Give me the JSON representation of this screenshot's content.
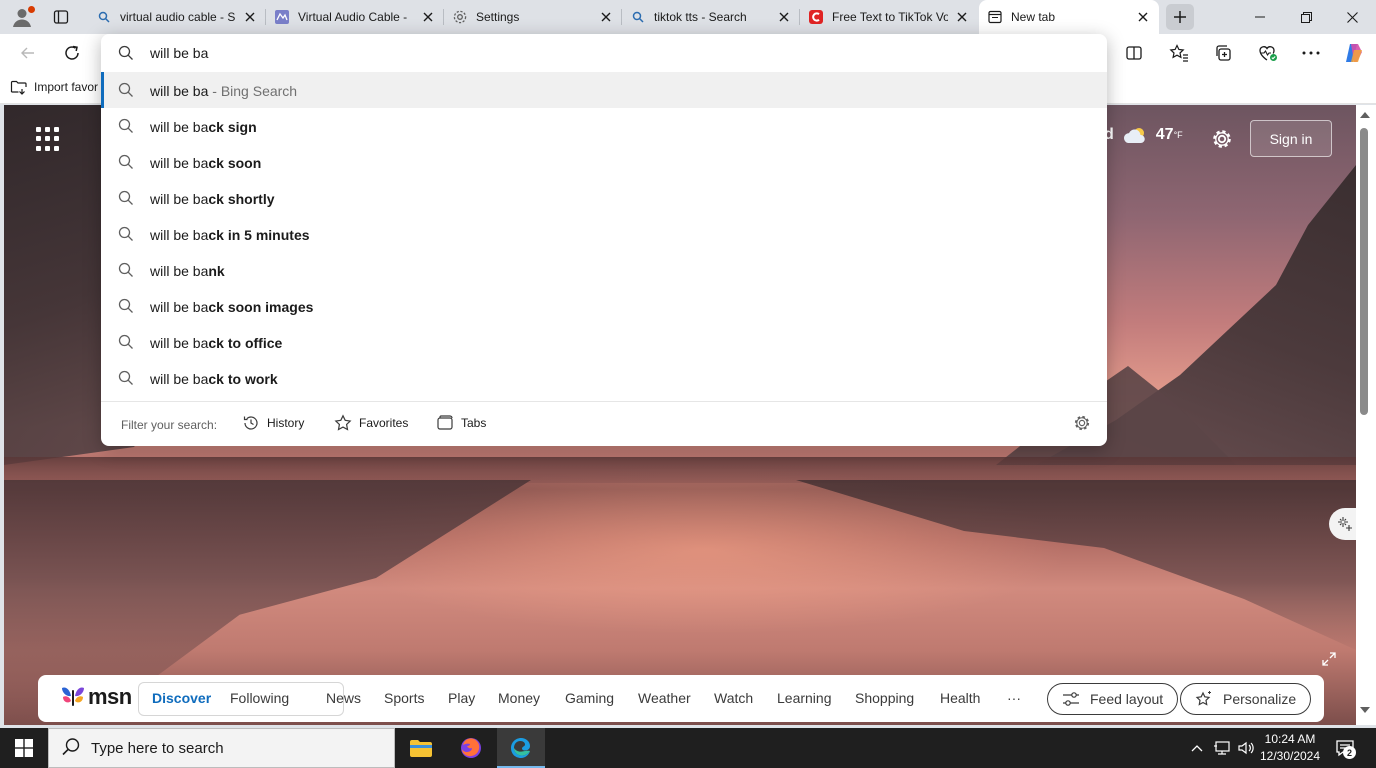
{
  "tabs": [
    {
      "title": "virtual audio cable - S",
      "favicon": "search-icon",
      "active": false
    },
    {
      "title": "Virtual Audio Cable -",
      "favicon": "vac-icon",
      "active": false
    },
    {
      "title": "Settings",
      "favicon": "gear-icon",
      "active": false
    },
    {
      "title": "tiktok tts - Search",
      "favicon": "search-icon",
      "active": false
    },
    {
      "title": "Free Text to TikTok Vo",
      "favicon": "red-c-icon",
      "active": false
    },
    {
      "title": "New tab",
      "favicon": "newtab-icon",
      "active": true
    }
  ],
  "favorites_bar": {
    "import_label": "Import favor"
  },
  "address": {
    "value": "will be ba",
    "suggestions": [
      {
        "typed": "will be ba",
        "completion": "",
        "suffix": " - Bing Search",
        "highlighted": true
      },
      {
        "typed": "will be ba",
        "completion": "ck sign",
        "suffix": "",
        "highlighted": false
      },
      {
        "typed": "will be ba",
        "completion": "ck soon",
        "suffix": "",
        "highlighted": false
      },
      {
        "typed": "will be ba",
        "completion": "ck shortly",
        "suffix": "",
        "highlighted": false
      },
      {
        "typed": "will be ba",
        "completion": "ck in 5 minutes",
        "suffix": "",
        "highlighted": false
      },
      {
        "typed": "will be ba",
        "completion": "nk",
        "suffix": "",
        "highlighted": false
      },
      {
        "typed": "will be ba",
        "completion": "ck soon images",
        "suffix": "",
        "highlighted": false
      },
      {
        "typed": "will be ba",
        "completion": "ck to office",
        "suffix": "",
        "highlighted": false
      },
      {
        "typed": "will be ba",
        "completion": "ck to work",
        "suffix": "",
        "highlighted": false
      }
    ],
    "filter_label": "Filter your search:",
    "filters": [
      {
        "label": "History",
        "icon": "history-icon"
      },
      {
        "label": "Favorites",
        "icon": "star-icon"
      },
      {
        "label": "Tabs",
        "icon": "tabs-icon"
      }
    ]
  },
  "page": {
    "weather_location_fragment": "d",
    "weather_temp": "47",
    "weather_unit": "°F",
    "signin_label": "Sign in"
  },
  "msn": {
    "logo_text": "msn",
    "nav": [
      {
        "label": "Discover",
        "active": true
      },
      {
        "label": "Following",
        "active": false
      },
      {
        "label": "News",
        "active": false
      },
      {
        "label": "Sports",
        "active": false
      },
      {
        "label": "Play",
        "active": false
      },
      {
        "label": "Money",
        "active": false
      },
      {
        "label": "Gaming",
        "active": false
      },
      {
        "label": "Weather",
        "active": false
      },
      {
        "label": "Watch",
        "active": false
      },
      {
        "label": "Learning",
        "active": false
      },
      {
        "label": "Shopping",
        "active": false
      },
      {
        "label": "Health",
        "active": false
      }
    ],
    "more_label": "···",
    "feed_layout_label": "Feed layout",
    "personalize_label": "Personalize"
  },
  "taskbar": {
    "search_placeholder": "Type here to search",
    "time": "10:24 AM",
    "date": "12/30/2024",
    "notification_count": "2"
  },
  "colors": {
    "accent": "#0f6cbd",
    "taskbar": "#1f1f1f"
  }
}
